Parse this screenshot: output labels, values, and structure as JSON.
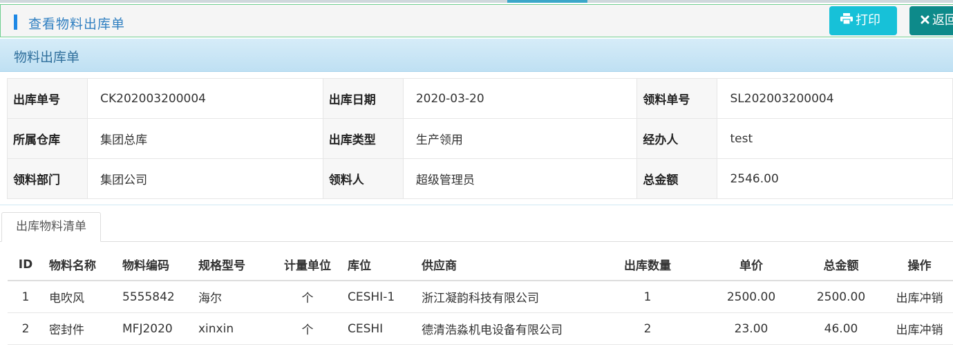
{
  "header": {
    "title": "查看物料出库单",
    "print_label": "打印",
    "back_label": "返回"
  },
  "panel": {
    "title": "物料出库单"
  },
  "info": [
    [
      {
        "label": "出库单号",
        "value": "CK202003200004"
      },
      {
        "label": "出库日期",
        "value": "2020-03-20"
      },
      {
        "label": "领料单号",
        "value": "SL202003200004"
      }
    ],
    [
      {
        "label": "所属仓库",
        "value": "集团总库"
      },
      {
        "label": "出库类型",
        "value": "生产领用"
      },
      {
        "label": "经办人",
        "value": "test"
      }
    ],
    [
      {
        "label": "领料部门",
        "value": "集团公司"
      },
      {
        "label": "领料人",
        "value": "超级管理员"
      },
      {
        "label": "总金额",
        "value": "2546.00"
      }
    ]
  ],
  "tab": {
    "label": "出库物料清单"
  },
  "items": {
    "columns": [
      "ID",
      "物料名称",
      "物料编码",
      "规格型号",
      "计量单位",
      "库位",
      "供应商",
      "出库数量",
      "单价",
      "总金额",
      "操作"
    ],
    "rows": [
      {
        "id": "1",
        "name": "电吹风",
        "code": "5555842",
        "spec": "海尔",
        "unit": "个",
        "location": "CESHI-1",
        "supplier": "浙江凝韵科技有限公司",
        "qty": "1",
        "price": "2500.00",
        "total": "2500.00",
        "action": "出库冲销"
      },
      {
        "id": "2",
        "name": "密封件",
        "code": "MFJ2020",
        "spec": "xinxin",
        "unit": "个",
        "location": "CESHI",
        "supplier": "德清浩淼机电设备有限公司",
        "qty": "2",
        "price": "23.00",
        "total": "46.00",
        "action": "出库冲销"
      }
    ]
  },
  "icons": {
    "print": "printer-icon",
    "back": "close-icon"
  },
  "colors": {
    "accent": "#1e88e5",
    "print_button": "#17c1d8",
    "back_button": "#0d8a8a",
    "link": "#2f7fc1"
  }
}
